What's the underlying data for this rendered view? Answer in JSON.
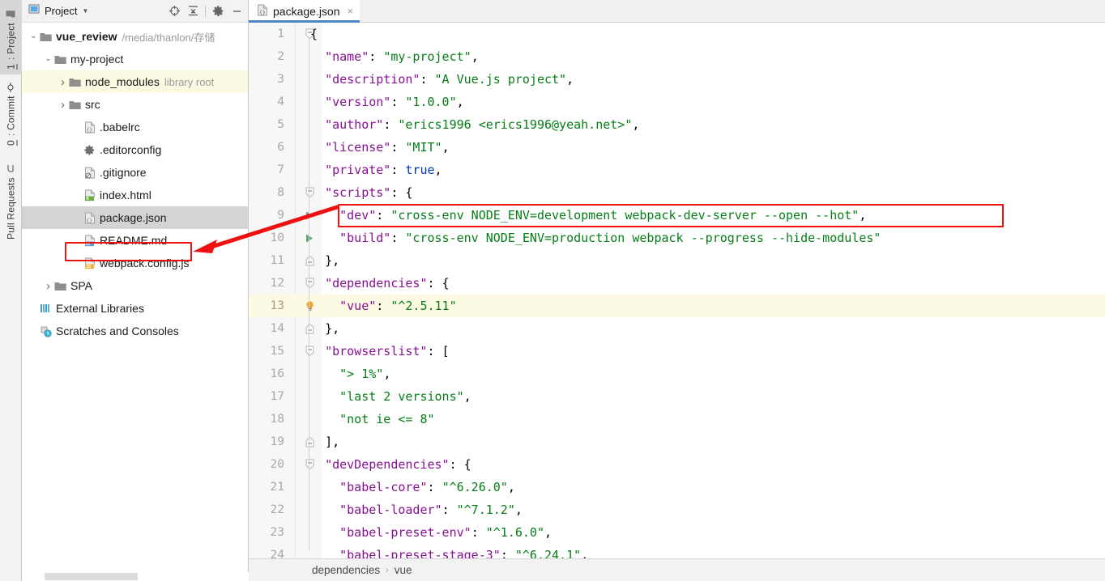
{
  "toolstrip": {
    "tabs": [
      {
        "id": "project",
        "num": "1",
        "label": ": Project",
        "active": true,
        "icon": "folder-icon"
      },
      {
        "id": "commit",
        "num": "0",
        "label": ": Commit",
        "active": false,
        "icon": "commit-icon"
      },
      {
        "id": "pull-requests",
        "num": "",
        "label": "Pull Requests",
        "active": false,
        "icon": "pull-request-icon"
      }
    ]
  },
  "project_panel": {
    "title": "Project",
    "icons": [
      "locate-target-icon",
      "collapse-all-icon",
      "gear-icon",
      "minimize-icon"
    ],
    "tree": [
      {
        "indent": 0,
        "arrow": "down",
        "icon": "folder-icon",
        "label": "vue_review",
        "bold": true,
        "sub": "/media/thanlon/存储",
        "state": "normal"
      },
      {
        "indent": 1,
        "arrow": "down",
        "icon": "folder-icon",
        "label": "my-project",
        "bold": false,
        "sub": "",
        "state": "normal"
      },
      {
        "indent": 2,
        "arrow": "right",
        "icon": "folder-icon",
        "label": "node_modules",
        "bold": false,
        "sub": "library root",
        "state": "hl"
      },
      {
        "indent": 2,
        "arrow": "right",
        "icon": "folder-icon",
        "label": "src",
        "bold": false,
        "sub": "",
        "state": "normal"
      },
      {
        "indent": 3,
        "arrow": "none",
        "icon": "json-file-icon",
        "label": ".babelrc",
        "bold": false,
        "sub": "",
        "state": "normal"
      },
      {
        "indent": 3,
        "arrow": "none",
        "icon": "editorconfig-icon",
        "label": ".editorconfig",
        "bold": false,
        "sub": "",
        "state": "normal"
      },
      {
        "indent": 3,
        "arrow": "none",
        "icon": "gitignore-file-icon",
        "label": ".gitignore",
        "bold": false,
        "sub": "",
        "state": "normal"
      },
      {
        "indent": 3,
        "arrow": "none",
        "icon": "html-file-icon",
        "label": "index.html",
        "bold": false,
        "sub": "",
        "state": "normal"
      },
      {
        "indent": 3,
        "arrow": "none",
        "icon": "json-file-icon",
        "label": "package.json",
        "bold": false,
        "sub": "",
        "state": "selected"
      },
      {
        "indent": 3,
        "arrow": "none",
        "icon": "markdown-file-icon",
        "label": "README.md",
        "bold": false,
        "sub": "",
        "state": "normal"
      },
      {
        "indent": 3,
        "arrow": "none",
        "icon": "js-file-icon",
        "label": "webpack.config.js",
        "bold": false,
        "sub": "",
        "state": "annotated"
      },
      {
        "indent": 1,
        "arrow": "right",
        "icon": "folder-icon",
        "label": "SPA",
        "bold": false,
        "sub": "",
        "state": "normal"
      },
      {
        "indent": 0,
        "arrow": "none",
        "icon": "external-libraries-icon",
        "label": "External Libraries",
        "bold": false,
        "sub": "",
        "state": "normal"
      },
      {
        "indent": 0,
        "arrow": "none",
        "icon": "scratches-icon",
        "label": "Scratches and Consoles",
        "bold": false,
        "sub": "",
        "state": "normal"
      }
    ]
  },
  "editor": {
    "tabs": [
      {
        "label": "package.json",
        "icon": "json-file-icon",
        "active": true,
        "close": "×"
      }
    ],
    "current_line": 13,
    "annotated_line": 9,
    "run_arrow_lines": [
      9,
      10
    ],
    "fold_lines": [
      1,
      8,
      11,
      12,
      14,
      15,
      19,
      20
    ],
    "lines": [
      {
        "n": 1,
        "indent": 0,
        "tokens": [
          {
            "t": "{",
            "c": "p"
          }
        ]
      },
      {
        "n": 2,
        "indent": 2,
        "tokens": [
          {
            "t": "\"name\"",
            "c": "k"
          },
          {
            "t": ": ",
            "c": "p"
          },
          {
            "t": "\"my-project\"",
            "c": "s"
          },
          {
            "t": ",",
            "c": "p"
          }
        ]
      },
      {
        "n": 3,
        "indent": 2,
        "tokens": [
          {
            "t": "\"description\"",
            "c": "k"
          },
          {
            "t": ": ",
            "c": "p"
          },
          {
            "t": "\"A Vue.js project\"",
            "c": "s"
          },
          {
            "t": ",",
            "c": "p"
          }
        ]
      },
      {
        "n": 4,
        "indent": 2,
        "tokens": [
          {
            "t": "\"version\"",
            "c": "k"
          },
          {
            "t": ": ",
            "c": "p"
          },
          {
            "t": "\"1.0.0\"",
            "c": "s"
          },
          {
            "t": ",",
            "c": "p"
          }
        ]
      },
      {
        "n": 5,
        "indent": 2,
        "tokens": [
          {
            "t": "\"author\"",
            "c": "k"
          },
          {
            "t": ": ",
            "c": "p"
          },
          {
            "t": "\"erics1996 <erics1996@yeah.net>\"",
            "c": "s"
          },
          {
            "t": ",",
            "c": "p"
          }
        ]
      },
      {
        "n": 6,
        "indent": 2,
        "tokens": [
          {
            "t": "\"license\"",
            "c": "k"
          },
          {
            "t": ": ",
            "c": "p"
          },
          {
            "t": "\"MIT\"",
            "c": "s"
          },
          {
            "t": ",",
            "c": "p"
          }
        ]
      },
      {
        "n": 7,
        "indent": 2,
        "tokens": [
          {
            "t": "\"private\"",
            "c": "k"
          },
          {
            "t": ": ",
            "c": "p"
          },
          {
            "t": "true",
            "c": "b"
          },
          {
            "t": ",",
            "c": "p"
          }
        ]
      },
      {
        "n": 8,
        "indent": 2,
        "tokens": [
          {
            "t": "\"scripts\"",
            "c": "k"
          },
          {
            "t": ": {",
            "c": "p"
          }
        ]
      },
      {
        "n": 9,
        "indent": 4,
        "tokens": [
          {
            "t": "\"dev\"",
            "c": "k"
          },
          {
            "t": ": ",
            "c": "p"
          },
          {
            "t": "\"cross-env NODE_ENV=development webpack-dev-server --open --hot\"",
            "c": "s"
          },
          {
            "t": ",",
            "c": "p"
          }
        ]
      },
      {
        "n": 10,
        "indent": 4,
        "tokens": [
          {
            "t": "\"build\"",
            "c": "k"
          },
          {
            "t": ": ",
            "c": "p"
          },
          {
            "t": "\"cross-env NODE_ENV=production webpack --progress --hide-modules\"",
            "c": "s"
          }
        ]
      },
      {
        "n": 11,
        "indent": 2,
        "tokens": [
          {
            "t": "},",
            "c": "p"
          }
        ]
      },
      {
        "n": 12,
        "indent": 2,
        "tokens": [
          {
            "t": "\"dependencies\"",
            "c": "k"
          },
          {
            "t": ": {",
            "c": "p"
          }
        ]
      },
      {
        "n": 13,
        "indent": 4,
        "tokens": [
          {
            "t": "\"vue\"",
            "c": "k"
          },
          {
            "t": ": ",
            "c": "p"
          },
          {
            "t": "\"^2.5.11\"",
            "c": "s"
          }
        ]
      },
      {
        "n": 14,
        "indent": 2,
        "tokens": [
          {
            "t": "},",
            "c": "p"
          }
        ]
      },
      {
        "n": 15,
        "indent": 2,
        "tokens": [
          {
            "t": "\"browserslist\"",
            "c": "k"
          },
          {
            "t": ": [",
            "c": "p"
          }
        ]
      },
      {
        "n": 16,
        "indent": 4,
        "tokens": [
          {
            "t": "\"> 1%\"",
            "c": "s"
          },
          {
            "t": ",",
            "c": "p"
          }
        ]
      },
      {
        "n": 17,
        "indent": 4,
        "tokens": [
          {
            "t": "\"last 2 versions\"",
            "c": "s"
          },
          {
            "t": ",",
            "c": "p"
          }
        ]
      },
      {
        "n": 18,
        "indent": 4,
        "tokens": [
          {
            "t": "\"not ie <= 8\"",
            "c": "s"
          }
        ]
      },
      {
        "n": 19,
        "indent": 2,
        "tokens": [
          {
            "t": "],",
            "c": "p"
          }
        ]
      },
      {
        "n": 20,
        "indent": 2,
        "tokens": [
          {
            "t": "\"devDependencies\"",
            "c": "k"
          },
          {
            "t": ": {",
            "c": "p"
          }
        ]
      },
      {
        "n": 21,
        "indent": 4,
        "tokens": [
          {
            "t": "\"babel-core\"",
            "c": "k"
          },
          {
            "t": ": ",
            "c": "p"
          },
          {
            "t": "\"^6.26.0\"",
            "c": "s"
          },
          {
            "t": ",",
            "c": "p"
          }
        ]
      },
      {
        "n": 22,
        "indent": 4,
        "tokens": [
          {
            "t": "\"babel-loader\"",
            "c": "k"
          },
          {
            "t": ": ",
            "c": "p"
          },
          {
            "t": "\"^7.1.2\"",
            "c": "s"
          },
          {
            "t": ",",
            "c": "p"
          }
        ]
      },
      {
        "n": 23,
        "indent": 4,
        "tokens": [
          {
            "t": "\"babel-preset-env\"",
            "c": "k"
          },
          {
            "t": ": ",
            "c": "p"
          },
          {
            "t": "\"^1.6.0\"",
            "c": "s"
          },
          {
            "t": ",",
            "c": "p"
          }
        ]
      },
      {
        "n": 24,
        "indent": 4,
        "tokens": [
          {
            "t": "\"babel-preset-stage-3\"",
            "c": "k"
          },
          {
            "t": ": ",
            "c": "p"
          },
          {
            "t": "\"^6.24.1\"",
            "c": "s"
          },
          {
            "t": ",",
            "c": "p"
          }
        ]
      }
    ]
  },
  "breadcrumb": {
    "items": [
      "dependencies",
      "vue"
    ],
    "separator": "›"
  },
  "annotations": {
    "color": "#ee1111",
    "box_code_label": "dev script line highlight",
    "box_file_label": "webpack.config.js highlight",
    "arrow_label": "pointer-arrow"
  },
  "colors": {
    "accent_tab_underline": "#4a86c8",
    "selection": "#d4d4d4",
    "current_line": "#fdfae3",
    "key_token": "#871094",
    "string_token": "#067d17",
    "bool_token": "#0033b3",
    "run_arrow": "#59a869",
    "annotation_red": "#ee1111"
  }
}
